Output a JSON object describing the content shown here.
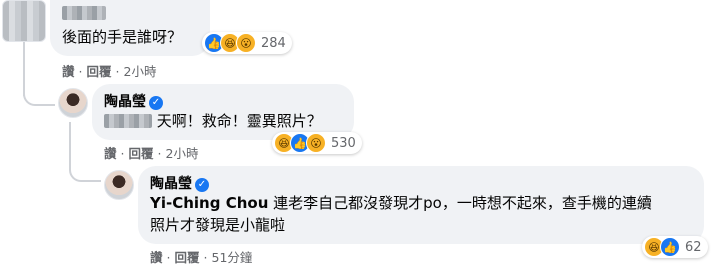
{
  "comments": [
    {
      "author": "",
      "text": "後面的手是誰呀？",
      "reactions": [
        "like",
        "haha",
        "wow"
      ],
      "reaction_count": "284",
      "actions": {
        "like": "讚",
        "reply": "回覆",
        "time": "2小時"
      }
    },
    {
      "author": "陶晶瑩",
      "verified": true,
      "text": "天啊！救命！靈異照片？",
      "reactions": [
        "haha",
        "like",
        "wow"
      ],
      "reaction_count": "530",
      "actions": {
        "like": "讚",
        "reply": "回覆",
        "time": "2小時"
      }
    },
    {
      "author": "陶晶瑩",
      "verified": true,
      "mention": "Yi-Ching Chou",
      "text_line1": " 連老李自己都沒發現才po，一時想不起來，查手機的連續",
      "text_line2": "照片才發現是小龍啦",
      "reactions": [
        "haha",
        "like"
      ],
      "reaction_count": "62",
      "actions": {
        "like": "讚",
        "reply": "回覆",
        "time": "51分鐘"
      }
    }
  ],
  "icons": {
    "like": "thumbs-up-icon",
    "haha": "laughing-face-icon",
    "wow": "surprised-face-icon",
    "verified": "verified-badge-icon"
  },
  "colors": {
    "bubble": "#f0f2f5",
    "muted": "#65676b",
    "link": "#1877f2",
    "connector": "#d0d3d8"
  }
}
